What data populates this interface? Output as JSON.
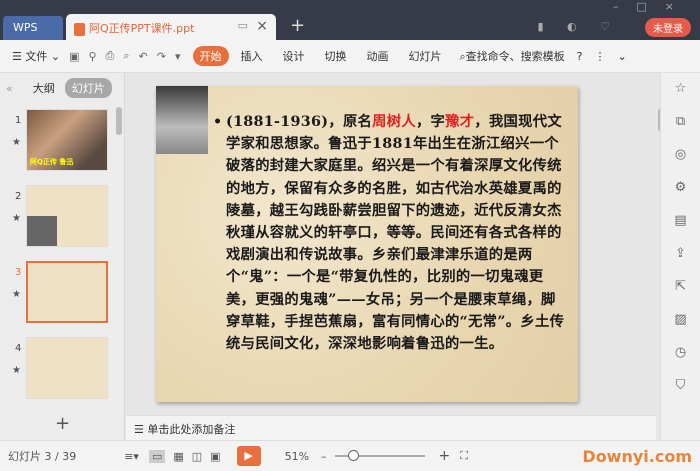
{
  "titlebar": {
    "wps_tab": "WPS",
    "doc_tab": "阿Q正传PPT课件.ppt",
    "login": "未登录"
  },
  "toolbar": {
    "file": "文件",
    "tabs": [
      "开始",
      "插入",
      "设计",
      "切换",
      "动画",
      "幻灯片"
    ],
    "search": "查找命令、搜索模板",
    "help": "?"
  },
  "left_panel": {
    "outline": "大纲",
    "slides": "幻灯片",
    "thumbs": [
      {
        "n": "1",
        "caption": "阿Q正传 鲁迅"
      },
      {
        "n": "2"
      },
      {
        "n": "3"
      },
      {
        "n": "4"
      }
    ]
  },
  "slide": {
    "bullet": "•",
    "t1": "(1881-1936)，原名",
    "name": "周树人",
    "t2": "，字",
    "courtesy": "豫才",
    "t3": "，我国现代文学家和思想家。鲁迅于1881年出生在浙江绍兴一个破落的封建大家庭里。绍兴是一个有着深厚文化传统的地方，保留有众多的名胜，如古代治水英雄夏禹的陵墓，越王勾践卧薪尝胆留下的遗迹，近代反清女杰秋瑾从容就义的轩亭口，等等。民间还有各式各样的戏剧演出和传说故事。乡亲们最津津乐道的是两个“鬼”：一个是“带复仇性的，比别的一切鬼魂更美，更强的鬼魂”——女吊；另一个是腰束草绳，脚穿草鞋，手捏芭蕉扇，富有同情心的“无常”。乡土传统与民间文化，深深地影响着鲁迅的一生。"
  },
  "notes": {
    "placeholder": "单击此处添加备注"
  },
  "status": {
    "slide_counter": "幻灯片 3 / 39",
    "zoom": "51%",
    "watermark": "Downyi.com"
  },
  "colors": {
    "accent": "#e8703f",
    "titlebar": "#363b47"
  }
}
